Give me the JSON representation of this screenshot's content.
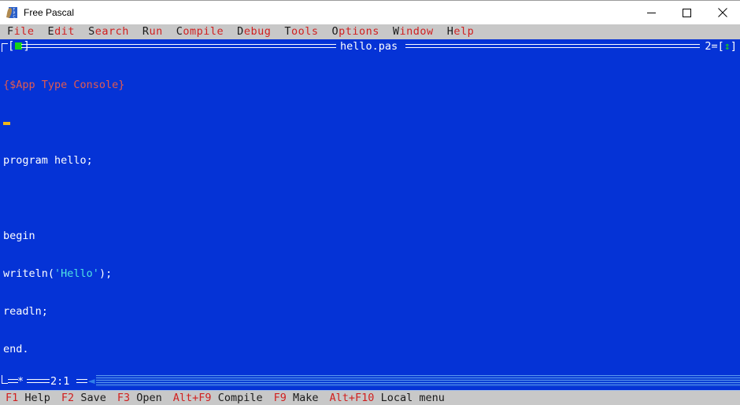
{
  "window": {
    "title": "Free Pascal",
    "icon": "free-pascal-logo-icon",
    "controls": {
      "minimize": "minimize-icon",
      "maximize": "maximize-icon",
      "close": "close-icon"
    }
  },
  "menubar": {
    "items": [
      {
        "hot": "F",
        "rest": "ile"
      },
      {
        "hot": "E",
        "rest": "dit"
      },
      {
        "hot": "S",
        "rest": "earch"
      },
      {
        "hot": "R",
        "rest": "un"
      },
      {
        "hot": "C",
        "rest": "ompile"
      },
      {
        "hot": "D",
        "rest": "ebug"
      },
      {
        "hot": "T",
        "rest": "ools"
      },
      {
        "hot": "O",
        "rest": "ptions"
      },
      {
        "hot": "W",
        "rest": "indow"
      },
      {
        "hot": "H",
        "rest": "elp"
      }
    ]
  },
  "editor_window": {
    "close_box_left": "[",
    "close_box_right": "]",
    "filename": "hello.pas",
    "window_number": "2=[",
    "resize_arrow": "↕",
    "window_number_end": "]",
    "modified_marker": "*",
    "cursor_position": "2:1",
    "scroll_left_arrow": "◄",
    "code_lines": [
      {
        "type": "directive",
        "text": "{$App Type Console}"
      },
      {
        "type": "caret",
        "text": ""
      },
      {
        "type": "plain",
        "text": "program hello;"
      },
      {
        "type": "plain",
        "text": ""
      },
      {
        "type": "plain",
        "text": "begin"
      },
      {
        "type": "code_string",
        "pre": "writeln(",
        "str": "'Hello'",
        "post": ");"
      },
      {
        "type": "plain",
        "text": "readln;"
      },
      {
        "type": "plain",
        "text": "end."
      }
    ]
  },
  "statusbar": {
    "items": [
      {
        "key": "F1",
        "label": "Help"
      },
      {
        "key": "F2",
        "label": "Save"
      },
      {
        "key": "F3",
        "label": "Open"
      },
      {
        "key": "Alt+F9",
        "label": "Compile"
      },
      {
        "key": "F9",
        "label": "Make"
      },
      {
        "key": "Alt+F10",
        "label": "Local menu"
      }
    ]
  },
  "colors": {
    "editor_background": "#0533d6",
    "menubar_background": "#c8c8c8",
    "menu_text": "#d02020",
    "menu_hotkey": "#1a1a1a",
    "directive_text": "#e25a50",
    "code_text": "#ffffff",
    "string_text": "#4fe2e2",
    "caret": "#f2b818",
    "close_box_square": "#18d218"
  }
}
